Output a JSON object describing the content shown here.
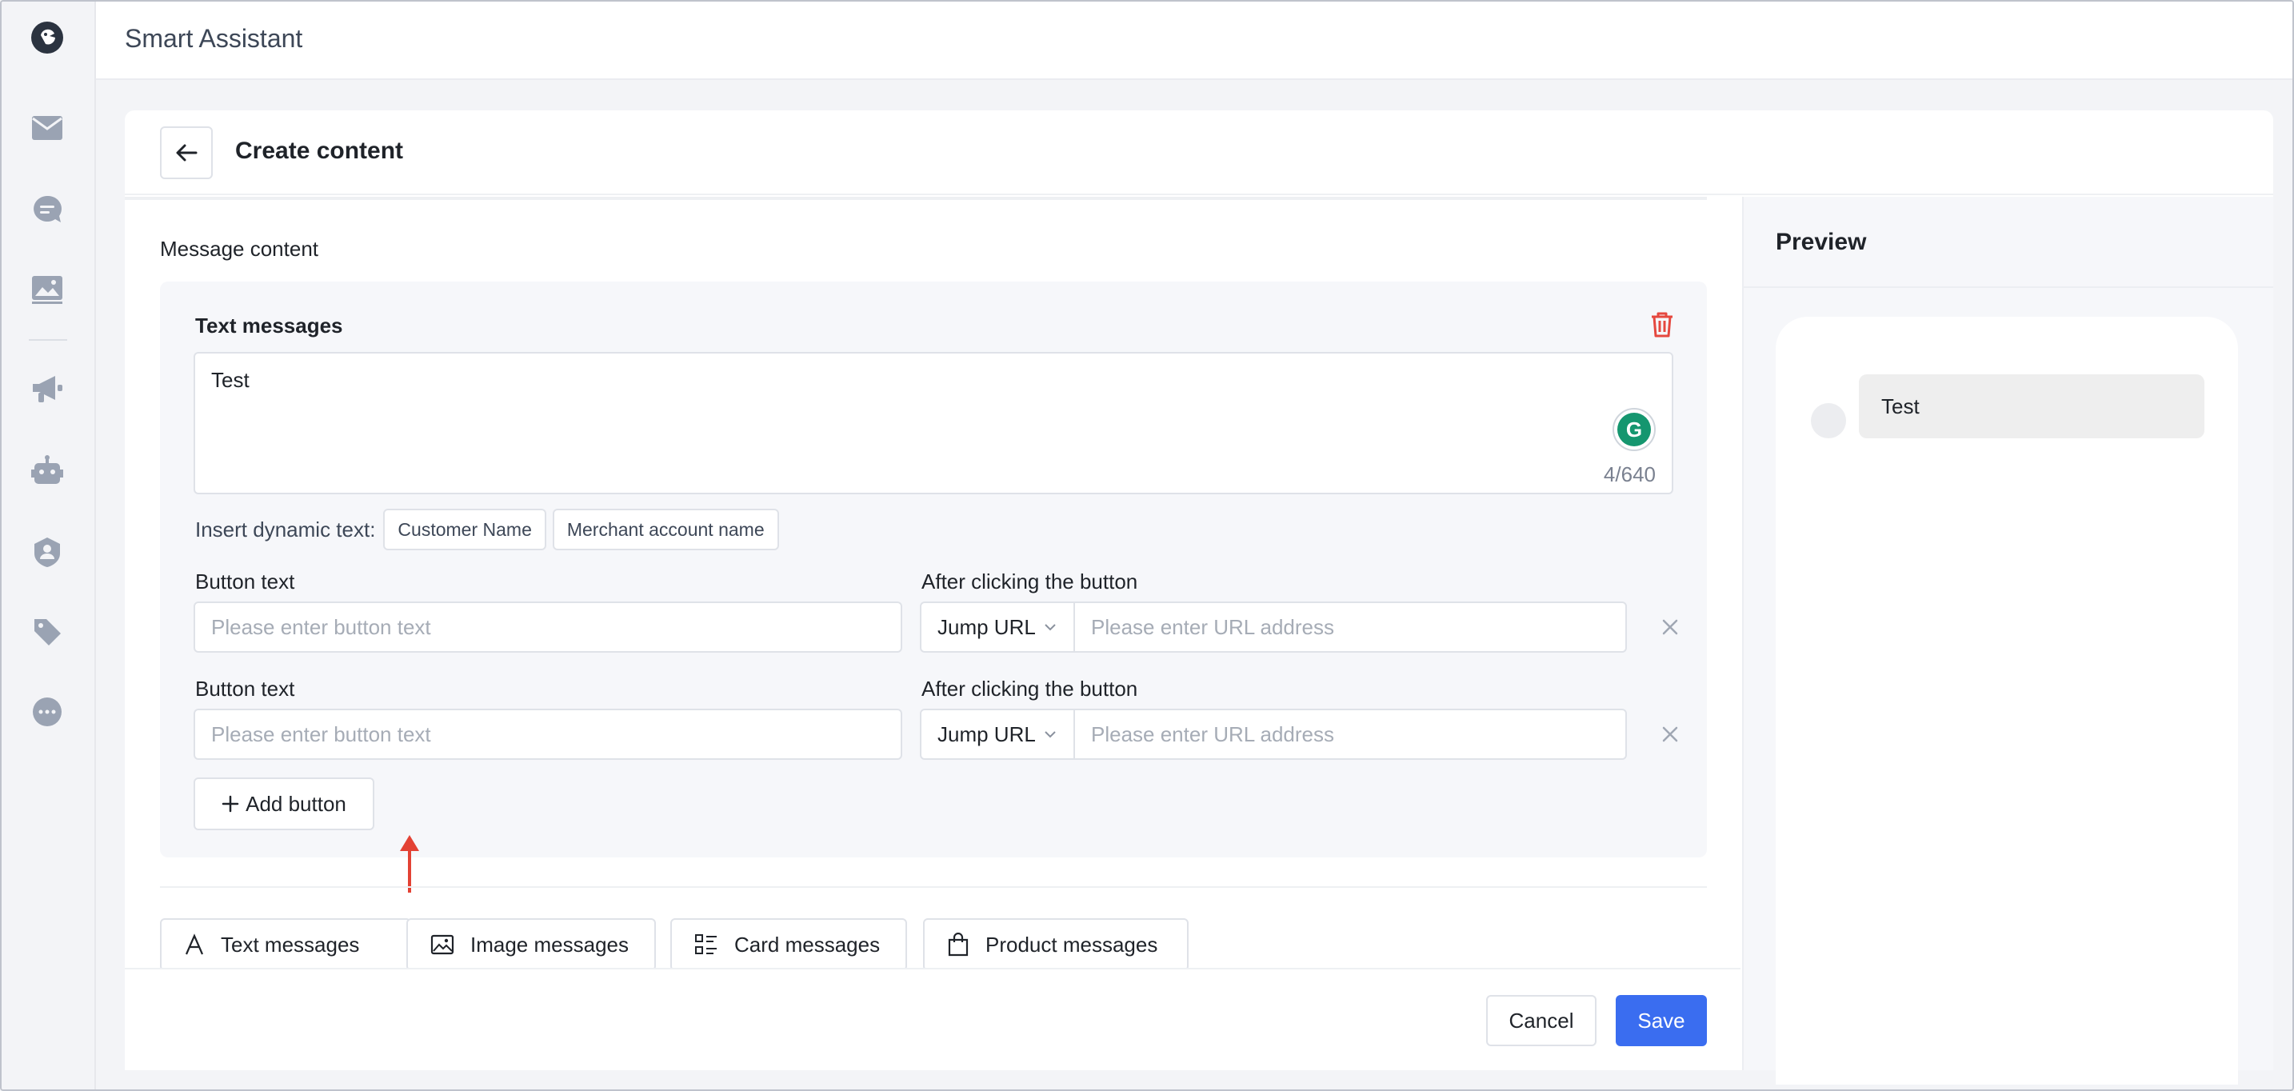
{
  "app": {
    "title": "Smart Assistant"
  },
  "sidebar": {
    "items": [
      {
        "name": "mail-icon"
      },
      {
        "name": "chat-icon"
      },
      {
        "name": "image-gallery-icon"
      },
      {
        "name": "megaphone-icon"
      },
      {
        "name": "robot-icon"
      },
      {
        "name": "user-shield-icon"
      },
      {
        "name": "tags-icon"
      },
      {
        "name": "more-icon"
      }
    ]
  },
  "page": {
    "title": "Create content"
  },
  "editor": {
    "section_label": "Message content",
    "text_message": {
      "title": "Text messages",
      "value": "Test",
      "counter": "4/640"
    },
    "dynamic_text": {
      "label": "Insert dynamic text:",
      "chips": [
        "Customer Name",
        "Merchant account name"
      ]
    },
    "buttons": [
      {
        "text_label": "Button text",
        "text_placeholder": "Please enter button text",
        "action_label": "After clicking the button",
        "action_value": "Jump URL",
        "url_placeholder": "Please enter URL address"
      },
      {
        "text_label": "Button text",
        "text_placeholder": "Please enter button text",
        "action_label": "After clicking the button",
        "action_value": "Jump URL",
        "url_placeholder": "Please enter URL address"
      }
    ],
    "add_button_label": "Add button",
    "message_types": [
      "Text messages",
      "Image messages",
      "Card messages",
      "Product messages"
    ]
  },
  "footer": {
    "cancel_label": "Cancel",
    "save_label": "Save"
  },
  "preview": {
    "title": "Preview",
    "bubble_text": "Test"
  },
  "colors": {
    "accent": "#3a6df0",
    "danger": "#e5483f",
    "annotation_arrow": "#e34234"
  }
}
